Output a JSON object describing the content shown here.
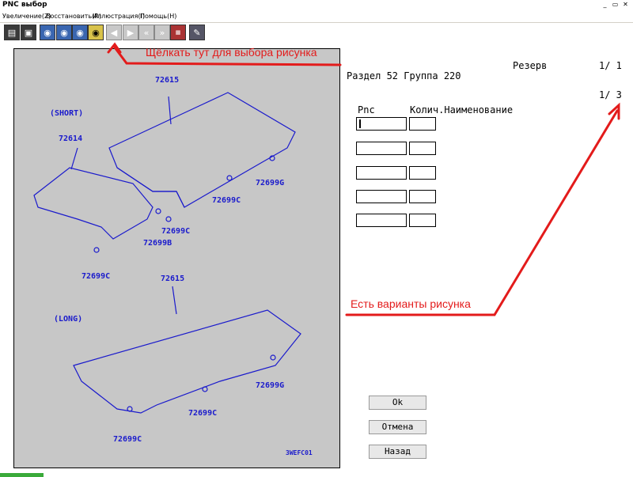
{
  "window": {
    "title": "PNC выбор",
    "btn_min": "_",
    "btn_max": "▭",
    "btn_close": "✕"
  },
  "menu": [
    "Увеличение(Z)",
    "Восстановить(R)",
    "Иллюстрация(I)",
    "Помощь(H)"
  ],
  "illustration": {
    "labels": {
      "short": "(SHORT)",
      "long": "(LONG)",
      "p1": "72615",
      "p2": "72614",
      "p3": "72699G",
      "p4": "72699C",
      "p5": "72699C",
      "p6": "72699B",
      "p7": "72699C",
      "p8": "72615",
      "p9": "72699G",
      "p10": "72699C",
      "p11": "72699C",
      "code": "3WEFC01"
    }
  },
  "info": {
    "reserve_label": "Резерв",
    "reserve_page": "1/ 1",
    "section": "Раздел 52 Группа 220",
    "variant_page": "1/ 3",
    "col_pnc": "Pnc",
    "col_qty_name": "Колич.Наименование"
  },
  "buttons": {
    "ok": "Ok",
    "cancel": "Отмена",
    "back": "Назад"
  },
  "annotations": {
    "click_here": "Щёлкать тут  для выбора рисунка",
    "variants": "Есть варианты рисунка",
    "color": "#e31b1b"
  }
}
